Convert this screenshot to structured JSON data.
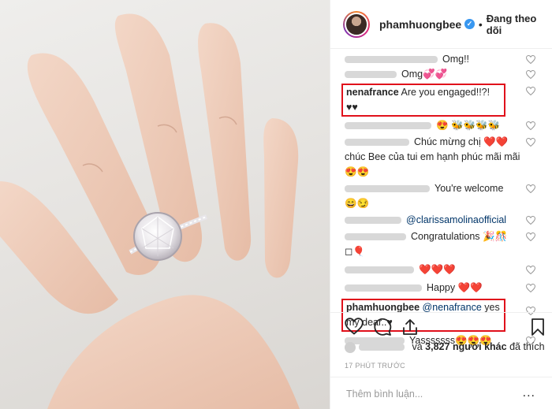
{
  "post": {
    "owner_username": "phamhuongbee",
    "follow_status": "Đang theo dõi",
    "verified": true
  },
  "comments": [
    {
      "text": "Omg!!"
    },
    {
      "text": "Omg💞💞"
    },
    {
      "username": "nenafrance",
      "text": "Are you engaged!!?!♥♥"
    },
    {
      "text": "😍 🐝🐝🐝🐝"
    },
    {
      "text": "Chúc mừng chị ❤️❤️ chúc Bee của tui em hạnh phúc mãi mãi 😍😍"
    },
    {
      "text": "You're welcome"
    },
    {
      "text": "😄😏"
    },
    {
      "mention": "@clarissamolinaofficial"
    },
    {
      "text": "Congratulations 🎉🎊"
    },
    {
      "text": "◻🎈"
    },
    {
      "text": "❤️❤️❤️"
    },
    {
      "text": "Happy ❤️❤️"
    },
    {
      "username": "phamhuongbee",
      "mention": "@nenafrance",
      "text": "yes my dear..♥"
    },
    {
      "text": "Yasssssss😍😍😍"
    }
  ],
  "likes": {
    "prefix": "và",
    "count": "3,827",
    "suffix": "người khác",
    "tail": "đã thích"
  },
  "timestamp": "17 PHÚT TRƯỚC",
  "add_comment_placeholder": "Thêm bình luận...",
  "more_icon": "..."
}
